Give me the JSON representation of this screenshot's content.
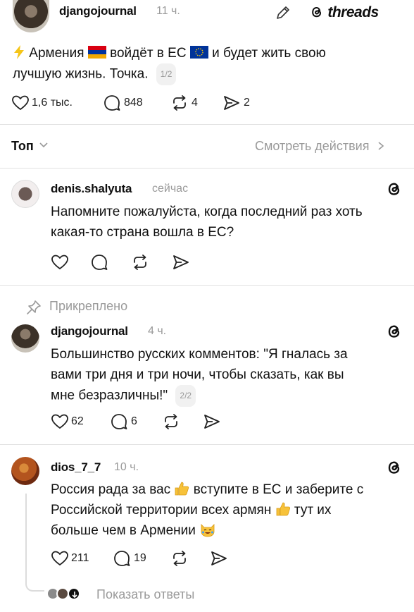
{
  "post": {
    "username": "djangojournal",
    "time": "11 ч.",
    "brand": "threads",
    "text_line1_a": "Армения",
    "text_line1_b": "войдёт в ЕС",
    "text_line1_c": "и будет жить свою",
    "text_line2": "лучшую жизнь. Точка.",
    "counter": "1/2",
    "likes": "1,6 тыс.",
    "comments": "848",
    "reposts": "4",
    "shares": "2"
  },
  "sort": {
    "label": "Топ",
    "activity_link": "Смотреть действия"
  },
  "replies": [
    {
      "username": "denis.shalyuta",
      "time": "сейчас",
      "line1": "Напомните пожалуйста, когда последний раз хоть",
      "line2": "какая-то страна вошла в ЕС?"
    },
    {
      "pinned_label": "Прикреплено",
      "username": "djangojournal",
      "time": "4 ч.",
      "line1": "Большинство русских комментов: \"Я гналась за",
      "line2": "вами три дня и три ночи, чтобы сказать, как вы",
      "line3": "мне безразличны!\"",
      "counter": "2/2",
      "likes": "62",
      "comments": "6"
    },
    {
      "username": "dios_7_7",
      "time": "10 ч.",
      "line1_a": "Россия рада за вас",
      "line1_b": "вступите в ЕС и заберите с",
      "line2_a": "Российской территории всех армян",
      "line2_b": "тут их",
      "line3": "больше чем в Армении",
      "likes": "211",
      "comments": "19",
      "show_replies": "Показать ответы"
    }
  ],
  "colors": {
    "text": "#101010",
    "muted": "#9a9a9a",
    "divider": "#e2e2e2",
    "lightning": "#f5c518",
    "armenia_flag": [
      "#d90012",
      "#0033a0",
      "#f2a800"
    ],
    "eu_flag": "#003399",
    "thumbs_up": "#f7c23a"
  },
  "icons": [
    "heart-icon",
    "comment-icon",
    "repost-icon",
    "share-icon",
    "edit-icon",
    "threads-logo-icon",
    "pin-icon",
    "chevron-down-icon",
    "chevron-right-icon"
  ]
}
